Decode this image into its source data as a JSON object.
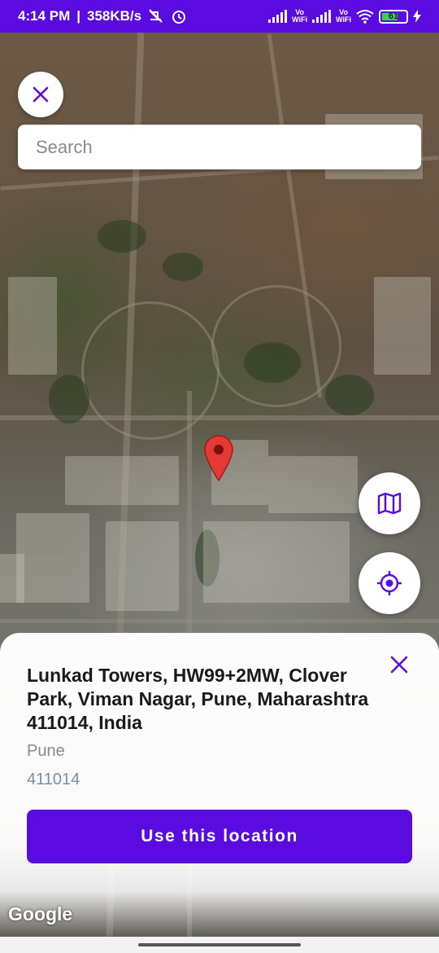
{
  "status_bar": {
    "time": "4:14 PM",
    "speed": "358KB/s",
    "sim1_label_top": "Vo",
    "sim1_label_bottom": "WiFi",
    "sim2_label_top": "Vo",
    "sim2_label_bottom": "WiFi",
    "battery": "61"
  },
  "search": {
    "placeholder": "Search"
  },
  "location": {
    "address": "Lunkad Towers, HW99+2MW, Clover Park, Viman Nagar, Pune, Maharashtra 411014, India",
    "city": "Pune",
    "pincode": "411014"
  },
  "actions": {
    "use_location_label": "Use this location"
  },
  "map": {
    "attribution": "Google"
  },
  "colors": {
    "accent": "#5a0be0",
    "pin": "#e53935"
  }
}
